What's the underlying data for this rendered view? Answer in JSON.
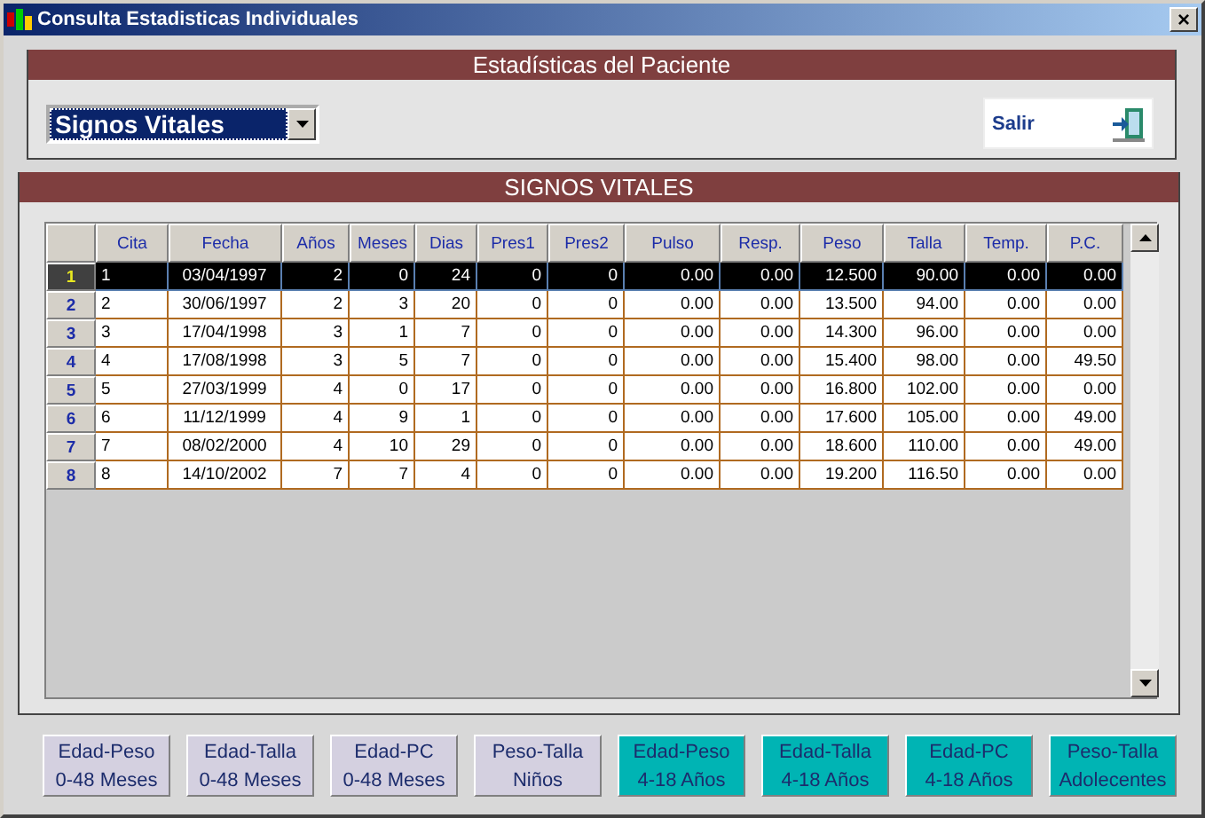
{
  "window": {
    "title": "Consulta Estadisticas Individuales",
    "close": "×"
  },
  "patient_panel": {
    "title": "Estadísticas del Paciente",
    "dropdown": {
      "value": "Signos Vitales"
    },
    "exit_button": "Salir"
  },
  "table": {
    "title": "SIGNOS VITALES",
    "columns": [
      "Cita",
      "Fecha",
      "Años",
      "Meses",
      "Dias",
      "Pres1",
      "Pres2",
      "Pulso",
      "Resp.",
      "Peso",
      "Talla",
      "Temp.",
      "P.C."
    ],
    "rows": [
      {
        "number": "1",
        "selected": true,
        "cells": [
          "1",
          "03/04/1997",
          "2",
          "0",
          "24",
          "0",
          "0",
          "0.00",
          "0.00",
          "12.500",
          "90.00",
          "0.00",
          "0.00"
        ]
      },
      {
        "number": "2",
        "selected": false,
        "cells": [
          "2",
          "30/06/1997",
          "2",
          "3",
          "20",
          "0",
          "0",
          "0.00",
          "0.00",
          "13.500",
          "94.00",
          "0.00",
          "0.00"
        ]
      },
      {
        "number": "3",
        "selected": false,
        "cells": [
          "3",
          "17/04/1998",
          "3",
          "1",
          "7",
          "0",
          "0",
          "0.00",
          "0.00",
          "14.300",
          "96.00",
          "0.00",
          "0.00"
        ]
      },
      {
        "number": "4",
        "selected": false,
        "cells": [
          "4",
          "17/08/1998",
          "3",
          "5",
          "7",
          "0",
          "0",
          "0.00",
          "0.00",
          "15.400",
          "98.00",
          "0.00",
          "49.50"
        ]
      },
      {
        "number": "5",
        "selected": false,
        "cells": [
          "5",
          "27/03/1999",
          "4",
          "0",
          "17",
          "0",
          "0",
          "0.00",
          "0.00",
          "16.800",
          "102.00",
          "0.00",
          "0.00"
        ]
      },
      {
        "number": "6",
        "selected": false,
        "cells": [
          "6",
          "11/12/1999",
          "4",
          "9",
          "1",
          "0",
          "0",
          "0.00",
          "0.00",
          "17.600",
          "105.00",
          "0.00",
          "49.00"
        ]
      },
      {
        "number": "7",
        "selected": false,
        "cells": [
          "7",
          "08/02/2000",
          "4",
          "10",
          "29",
          "0",
          "0",
          "0.00",
          "0.00",
          "18.600",
          "110.00",
          "0.00",
          "49.00"
        ]
      },
      {
        "number": "8",
        "selected": false,
        "cells": [
          "8",
          "14/10/2002",
          "7",
          "7",
          "4",
          "0",
          "0",
          "0.00",
          "0.00",
          "19.200",
          "116.50",
          "0.00",
          "0.00"
        ]
      }
    ]
  },
  "chart_buttons": [
    {
      "line1": "Edad-Peso",
      "line2": "0-48 Meses",
      "color": "#d4d0e0"
    },
    {
      "line1": "Edad-Talla",
      "line2": "0-48 Meses",
      "color": "#d4d0e0"
    },
    {
      "line1": "Edad-PC",
      "line2": "0-48 Meses",
      "color": "#d4d0e0"
    },
    {
      "line1": "Peso-Talla",
      "line2": "Niños",
      "color": "#d4d0e0"
    },
    {
      "line1": "Edad-Peso",
      "line2": "4-18 Años",
      "color": "#00b4b4"
    },
    {
      "line1": "Edad-Talla",
      "line2": "4-18 Años",
      "color": "#00b4b4"
    },
    {
      "line1": "Edad-PC",
      "line2": "4-18 Años",
      "color": "#00b4b4"
    },
    {
      "line1": "Peso-Talla",
      "line2": "Adolecentes",
      "color": "#00b4b4"
    }
  ]
}
